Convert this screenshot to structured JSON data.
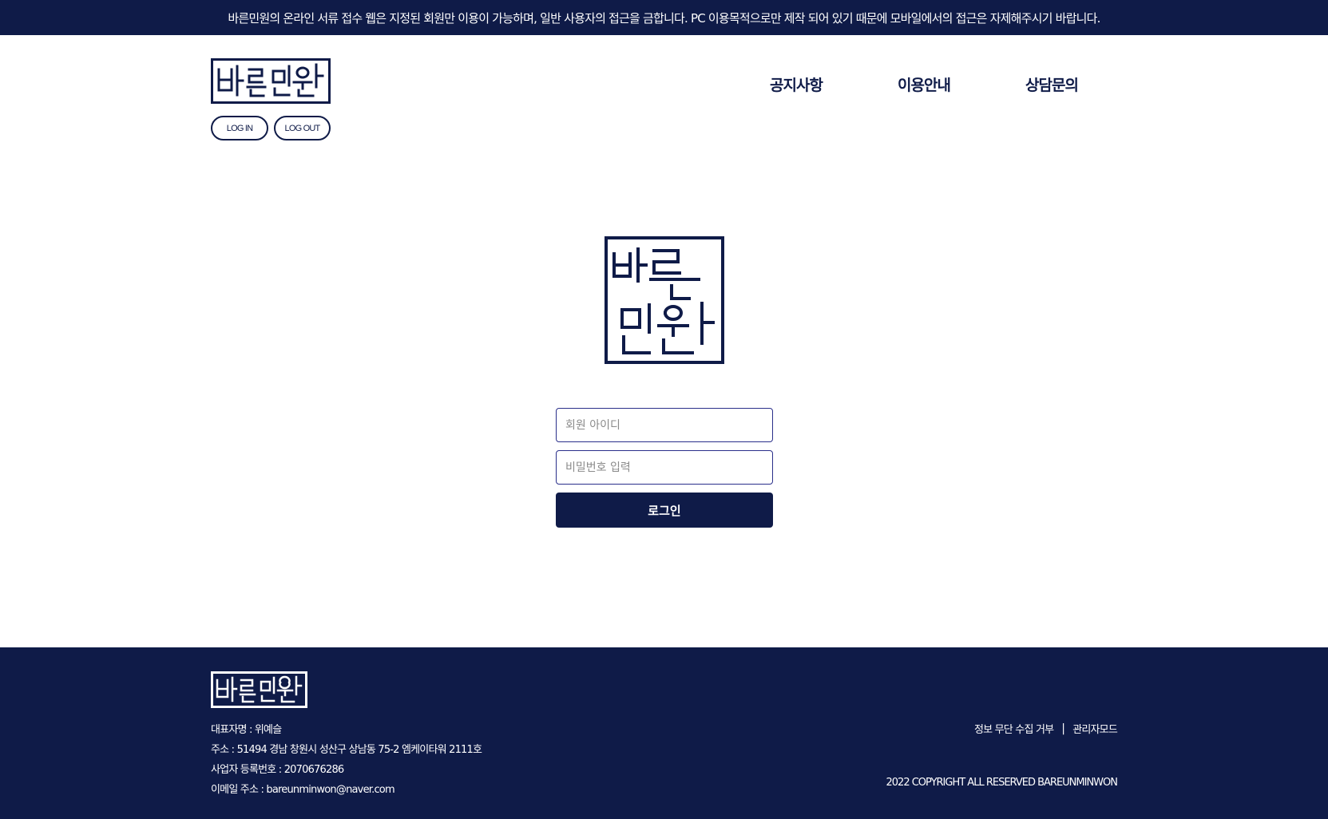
{
  "notice_bar": {
    "text": "바른민원의 온라인 서류 접수 웹은 지정된 회원만 이용이 가능하며, 일반 사용자의 접근을 금합니다. PC 이용목적으로만 제작 되어 있기 때문에 모바일에서의 접근은 자제해주시기 바랍니다."
  },
  "header": {
    "logo_text": "바른민원",
    "login_label": "LOG IN",
    "logout_label": "LOG OUT",
    "nav": [
      {
        "label": "공지사항"
      },
      {
        "label": "이용안내"
      },
      {
        "label": "상담문의"
      }
    ]
  },
  "login_form": {
    "logo_text": "바른민원",
    "id_placeholder": "회원 아이디",
    "id_value": "",
    "password_placeholder": "비밀번호 입력",
    "password_value": "",
    "submit_label": "로그인"
  },
  "footer": {
    "logo_text": "바른민원",
    "info": [
      "대표자명 : 위예슬",
      "주소 : 51494 경남 창원시 성산구 상남동 75-2 엠케이타워 2111호",
      "사업자 등록번호 : 2070676286",
      "이메일 주소 : bareunminwon@naver.com"
    ],
    "links": [
      "정보 무단 수집 거부",
      "관리자모드"
    ],
    "separator": "|",
    "copyright": "2022 COPYRIGHT ALL RESERVED BAREUNMINWON"
  },
  "colors": {
    "brand_navy": "#0f1b48",
    "input_border": "#2a2f8a",
    "background": "#ffffff"
  }
}
